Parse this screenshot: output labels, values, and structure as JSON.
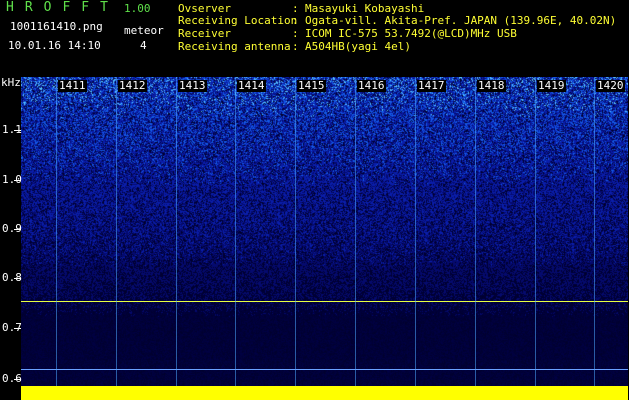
{
  "app": {
    "logo": "HROFFT",
    "version": "1.00",
    "filename": "1001161410.png",
    "datetime": "10.01.16 14:10",
    "meteor_label": "meteor",
    "meteor_count": "4"
  },
  "info": [
    {
      "key": "Ovserver",
      "value": "Masayuki Kobayashi"
    },
    {
      "key": "Receiving Location",
      "value": "Ogata-vill. Akita-Pref. JAPAN (139.96E, 40.02N)"
    },
    {
      "key": "Receiver",
      "value": "ICOM IC-575 53.7492(@LCD)MHz USB"
    },
    {
      "key": "Receiving antenna",
      "value": "A504HB(yagi 4el)"
    }
  ],
  "separator": ":",
  "axis": {
    "y_unit": "kHz",
    "y_ticks": [
      "1.1",
      "1.0",
      "0.9",
      "0.8",
      "0.7",
      "0.6"
    ],
    "x_ticks": [
      "1411",
      "1412",
      "1413",
      "1414",
      "1415",
      "1416",
      "1417",
      "1418",
      "1419",
      "1420"
    ]
  },
  "colors": {
    "header_text": "#5fe04a",
    "axis_text": "#ffffff",
    "marker": "#ffff00",
    "grid": "#4aa8ff"
  }
}
